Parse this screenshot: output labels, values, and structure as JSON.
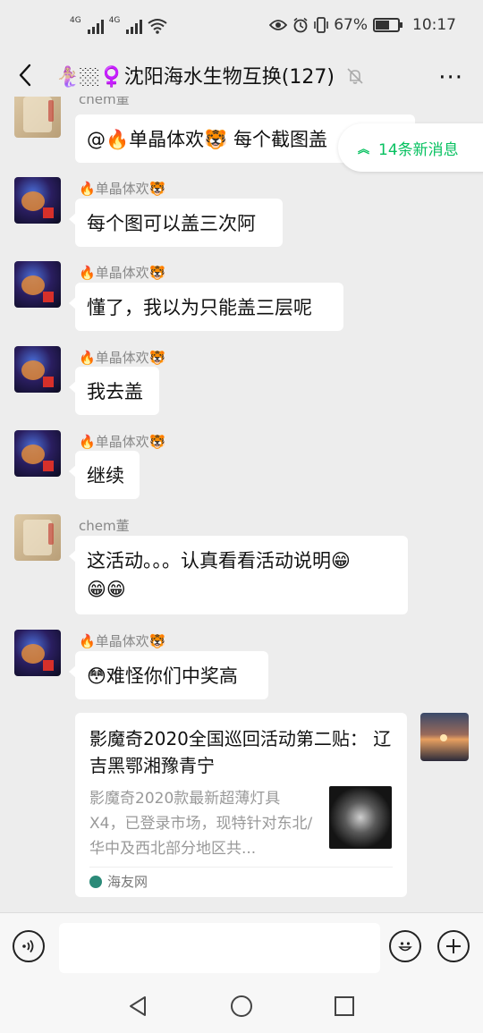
{
  "status_bar": {
    "signal1_label": "4G",
    "signal2_label": "4G",
    "battery_percent": "67%",
    "battery_level": 0.67,
    "time": "10:17"
  },
  "header": {
    "back_icon": "chevron-left-icon",
    "title": "🧜🏼‍♀️🏼‍♀️沈阳海水生物互换(127)",
    "mute_icon": "bell-off-icon",
    "more_label": "···"
  },
  "new_messages": {
    "label": "14条新消息",
    "icon": "double-chevron-up-icon"
  },
  "messages": [
    {
      "sender": "chem董",
      "text": "@🔥单晶体欢🐯  每个截图盖"
    },
    {
      "sender": "🔥单晶体欢🐯",
      "text": "每个图可以盖三次阿"
    },
    {
      "sender": "🔥单晶体欢🐯",
      "text": "懂了，我以为只能盖三层呢"
    },
    {
      "sender": "🔥单晶体欢🐯",
      "text": "我去盖"
    },
    {
      "sender": "🔥单晶体欢🐯",
      "text": "继续"
    },
    {
      "sender": "chem董",
      "text_line1": "这活动。。。认真看看活动说明😁",
      "text_line2": "😁😁"
    },
    {
      "sender": "🔥单晶体欢🐯",
      "text": "😳难怪你们中奖高"
    }
  ],
  "link_card": {
    "title": "影魔奇2020全国巡回活动第二贴： 辽吉黑鄂湘豫青宁",
    "description": "影魔奇2020款最新超薄灯具X4，已登录市场，现特针对东北/华中及西北部分地区共...",
    "source": "海友网"
  },
  "input_bar": {
    "voice_icon": "voice-icon",
    "emoji_icon": "emoji-icon",
    "plus_icon": "plus-icon",
    "field_value": ""
  },
  "nav_bar": {
    "back_icon": "triangle-back-icon",
    "home_icon": "circle-home-icon",
    "recent_icon": "square-recent-icon"
  },
  "colors": {
    "accent_green": "#07c160",
    "chat_background": "#ededed"
  }
}
